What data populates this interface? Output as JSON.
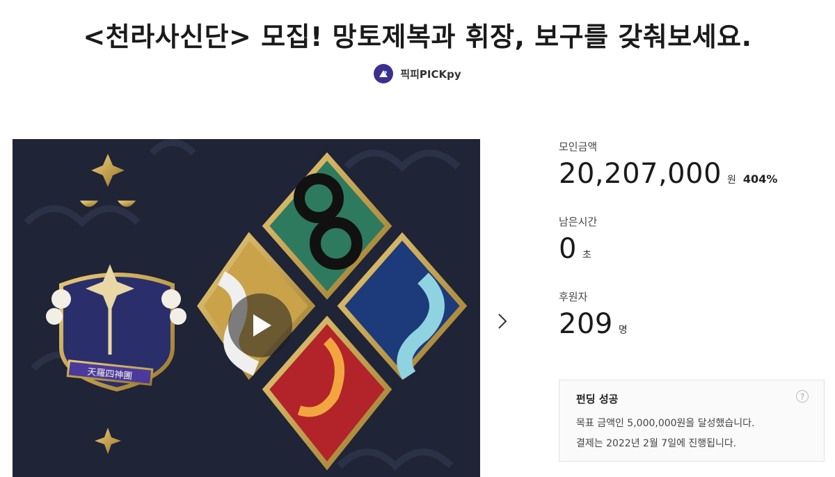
{
  "project": {
    "title": "<천라사신단> 모집! 망토제복과 휘장, 보구를 갖춰보세요.",
    "maker": "픽피PICKpy"
  },
  "media": {
    "alt": "천라사신단 휘장",
    "emblem_text": "天羅四神團",
    "bg_color": "#1f2436",
    "gold": "#c9a24a"
  },
  "stats": {
    "amount_label": "모인금액",
    "amount_value": "20,207,000",
    "amount_unit": "원",
    "amount_rate": "404%",
    "time_label": "남은시간",
    "time_value": "0",
    "time_unit": "초",
    "backers_label": "후원자",
    "backers_value": "209",
    "backers_unit": "명"
  },
  "notice": {
    "title": "펀딩 성공",
    "line1": "목표 금액인 5,000,000원을 달성했습니다.",
    "line2": "결제는 2022년 2월 7일에 진행됩니다.",
    "help": "?"
  },
  "icons": {
    "play": "play-icon",
    "next": "chevron-right-icon",
    "help": "question-circle-icon",
    "maker_logo": "maker-logo-icon"
  }
}
